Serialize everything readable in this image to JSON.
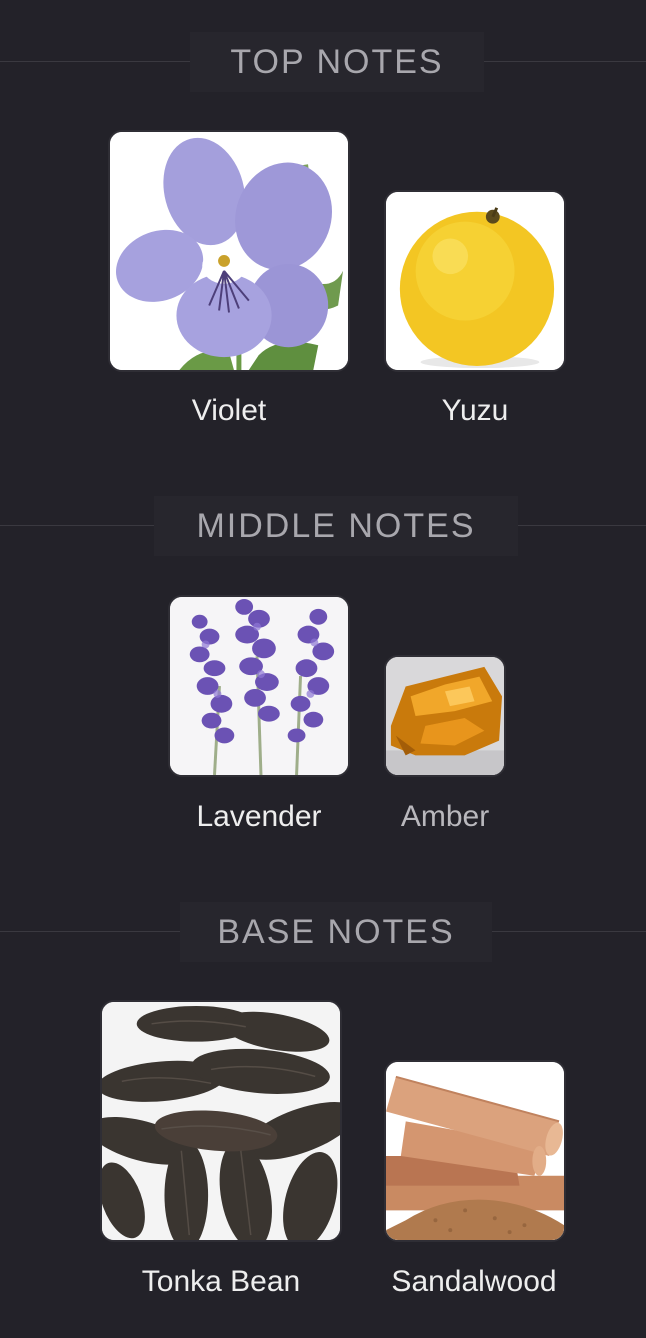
{
  "sections": [
    {
      "title": "TOP NOTES",
      "notes": [
        {
          "name": "Violet",
          "image": "violet-flower"
        },
        {
          "name": "Yuzu",
          "image": "yuzu-fruit"
        }
      ]
    },
    {
      "title": "MIDDLE NOTES",
      "notes": [
        {
          "name": "Lavender",
          "image": "lavender-sprigs"
        },
        {
          "name": "Amber",
          "image": "amber-resin"
        }
      ]
    },
    {
      "title": "BASE NOTES",
      "notes": [
        {
          "name": "Tonka Bean",
          "image": "tonka-beans"
        },
        {
          "name": "Sandalwood",
          "image": "sandalwood-sticks"
        }
      ]
    }
  ]
}
